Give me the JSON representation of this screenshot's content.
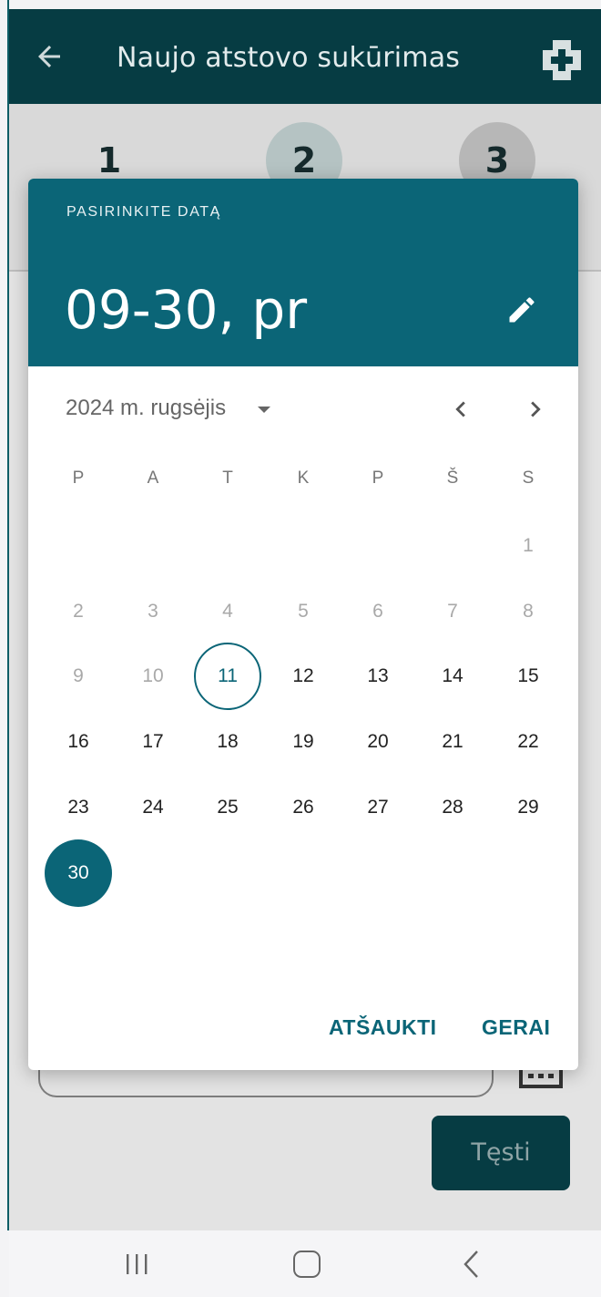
{
  "app_bar": {
    "title": "Naujo atstovo sukūrimas"
  },
  "steps": [
    "1",
    "2",
    "3"
  ],
  "continue_button": "Tęsti",
  "date_picker": {
    "header_label": "PASIRINKITE DATĄ",
    "selected_display": "09-30, pr",
    "month_label": "2024 m. rugsėjis",
    "weekdays": [
      "P",
      "A",
      "T",
      "K",
      "P",
      "Š",
      "S"
    ],
    "days": [
      {
        "n": "1",
        "state": "disabled"
      },
      {
        "n": "2",
        "state": "disabled"
      },
      {
        "n": "3",
        "state": "disabled"
      },
      {
        "n": "4",
        "state": "disabled"
      },
      {
        "n": "5",
        "state": "disabled"
      },
      {
        "n": "6",
        "state": "disabled"
      },
      {
        "n": "7",
        "state": "disabled"
      },
      {
        "n": "8",
        "state": "disabled"
      },
      {
        "n": "9",
        "state": "disabled"
      },
      {
        "n": "10",
        "state": "disabled"
      },
      {
        "n": "11",
        "state": "today"
      },
      {
        "n": "12",
        "state": "normal"
      },
      {
        "n": "13",
        "state": "normal"
      },
      {
        "n": "14",
        "state": "normal"
      },
      {
        "n": "15",
        "state": "normal"
      },
      {
        "n": "16",
        "state": "normal"
      },
      {
        "n": "17",
        "state": "normal"
      },
      {
        "n": "18",
        "state": "normal"
      },
      {
        "n": "19",
        "state": "normal"
      },
      {
        "n": "20",
        "state": "normal"
      },
      {
        "n": "21",
        "state": "normal"
      },
      {
        "n": "22",
        "state": "normal"
      },
      {
        "n": "23",
        "state": "normal"
      },
      {
        "n": "24",
        "state": "normal"
      },
      {
        "n": "25",
        "state": "normal"
      },
      {
        "n": "26",
        "state": "normal"
      },
      {
        "n": "27",
        "state": "normal"
      },
      {
        "n": "28",
        "state": "normal"
      },
      {
        "n": "29",
        "state": "normal"
      },
      {
        "n": "30",
        "state": "selected"
      }
    ],
    "cancel_label": "ATŠAUKTI",
    "ok_label": "GERAI"
  },
  "icons": {
    "back": "arrow-left-icon",
    "add": "plus-icon",
    "edit": "pencil-icon",
    "prev": "chevron-left-icon",
    "next": "chevron-right-icon",
    "calendar": "calendar-icon",
    "nav_recent": "recent-apps-icon",
    "nav_home": "home-icon",
    "nav_back": "nav-back-icon"
  },
  "colors": {
    "app_bar": "#063c43",
    "dialog_header": "#0b6577",
    "accent": "#0b6577"
  }
}
